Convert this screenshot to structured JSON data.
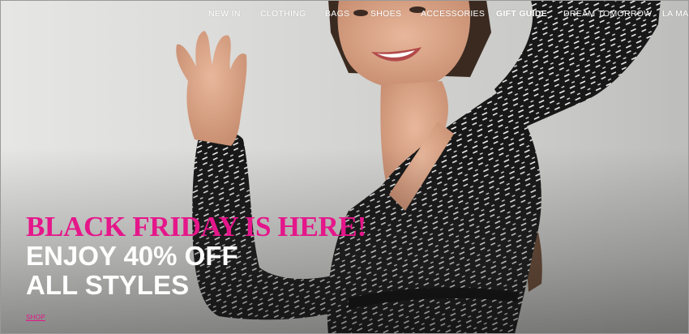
{
  "nav": {
    "items": [
      "NEW IN",
      "CLOTHING",
      "BAGS",
      "SHOES",
      "ACCESSORIES",
      "GIFT GUIDE",
      "DREAM TOMORROW",
      "LA MAI"
    ]
  },
  "hero": {
    "headline": "BLACK FRIDAY IS HERE!",
    "subline1": "ENJOY 40% OFF",
    "subline2": "ALL STYLES",
    "cta": "SHOP"
  },
  "colors": {
    "accent": "#e5168a",
    "nav_text": "#ffffff",
    "dress": "#1a1a1a"
  },
  "icons": [
    "hero-photo"
  ]
}
